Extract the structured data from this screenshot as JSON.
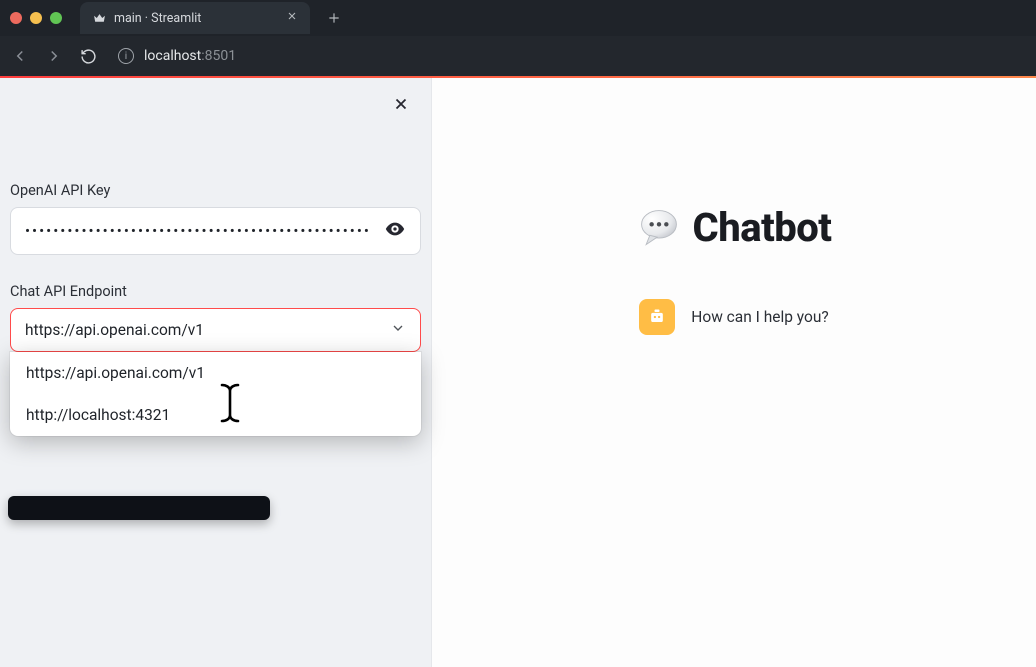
{
  "browser": {
    "tab_title": "main · Streamlit",
    "url_host": "localhost",
    "url_port": ":8501"
  },
  "sidebar": {
    "api_key_label": "OpenAI API Key",
    "api_key_value": "•••••••••••••••••••••••••••••••••••••••••••••••••",
    "endpoint_label": "Chat API Endpoint",
    "endpoint_value": "https://api.openai.com/v1",
    "endpoint_options": [
      "https://api.openai.com/v1",
      "http://localhost:4321"
    ]
  },
  "main": {
    "title": "Chatbot",
    "assistant_message": "How can I help you?"
  },
  "colors": {
    "accent": "#ff4b4b"
  }
}
